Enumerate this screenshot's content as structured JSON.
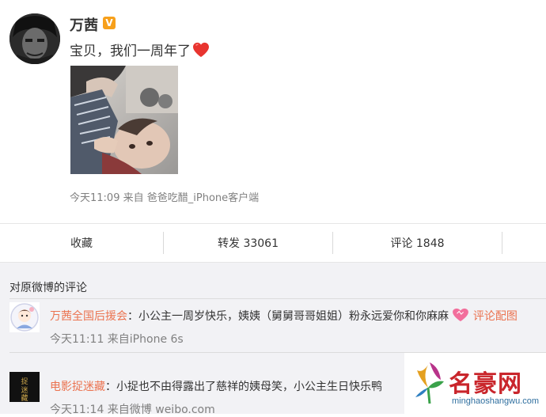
{
  "post": {
    "author": "万茜",
    "text": "宝贝，我们一周年了",
    "time": "今天11:09",
    "from_label": "来自",
    "client": "爸爸吃醋_iPhone客户端"
  },
  "actions": {
    "favorite": "收藏",
    "repost": "转发 33061",
    "comment": "评论 1848"
  },
  "comments_section": {
    "title": "对原微博的评论",
    "items": [
      {
        "author": "万茜全国后援会",
        "separator": "：",
        "text": "小公主一周岁快乐，姨姨（舅舅哥哥姐姐）粉永远爱你和你麻麻",
        "link": "评论配图",
        "meta": "今天11:11 来自iPhone 6s"
      },
      {
        "author": "电影捉迷藏",
        "separator": "：",
        "text": "小捉也不由得露出了慈祥的姨母笑，小公主生日快乐鸭",
        "meta": "今天11:14 来自微博 weibo.com",
        "avatar_text": "捉迷藏"
      }
    ]
  },
  "watermark": {
    "title": "名豪网",
    "subtitle": "minghaoshangwu.com"
  },
  "colors": {
    "link_orange": "#eb7350",
    "verified": "#f7a01b",
    "heart": "#e8342f",
    "watermark_red": "#c9252b"
  }
}
